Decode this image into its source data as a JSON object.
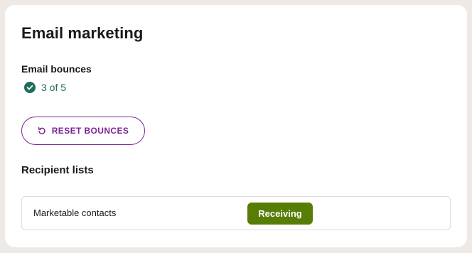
{
  "card": {
    "title": "Email marketing"
  },
  "bounces": {
    "label": "Email bounces",
    "count_text": "3 of 5",
    "icon": "check-circle-icon"
  },
  "reset_button": {
    "label": "RESET BOUNCES",
    "icon": "reset-icon"
  },
  "recipient_lists": {
    "heading": "Recipient lists",
    "rows": [
      {
        "name": "Marketable contacts",
        "status": "Receiving"
      }
    ]
  },
  "colors": {
    "page_background": "#efe9e6",
    "success_teal": "#1b6e5e",
    "brand_purple": "#7b2494",
    "badge_green": "#577d06"
  }
}
